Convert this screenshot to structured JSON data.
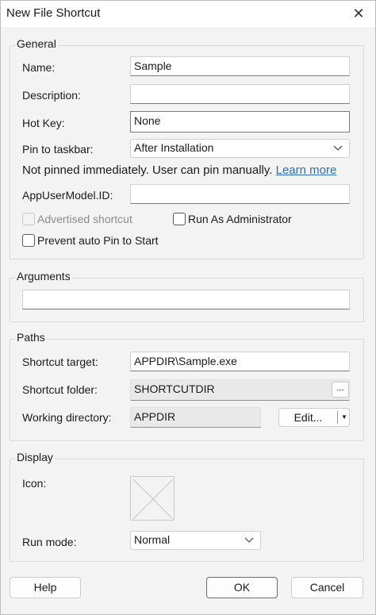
{
  "window": {
    "title": "New File Shortcut",
    "close_glyph": "✕"
  },
  "general": {
    "title": "General",
    "name_label": "Name:",
    "name_value": "Sample",
    "description_label": "Description:",
    "description_value": "",
    "hotkey_label": "Hot Key:",
    "hotkey_value": "None",
    "pin_label": "Pin to taskbar:",
    "pin_value": "After Installation",
    "pin_note": "Not pinned immediately. User can pin manually.",
    "learn_more": "Learn more",
    "appusermodel_label": "AppUserModel.ID:",
    "appusermodel_value": "",
    "advertised_label": "Advertised shortcut",
    "run_admin_label": "Run As Administrator",
    "prevent_pin_label": "Prevent auto Pin to Start"
  },
  "arguments": {
    "title": "Arguments",
    "value": ""
  },
  "paths": {
    "title": "Paths",
    "target_label": "Shortcut target:",
    "target_value": "APPDIR\\Sample.exe",
    "folder_label": "Shortcut folder:",
    "folder_value": "SHORTCUTDIR",
    "browse_label": "...",
    "workdir_label": "Working directory:",
    "workdir_value": "APPDIR",
    "edit_label": "Edit..."
  },
  "display": {
    "title": "Display",
    "icon_label": "Icon:",
    "runmode_label": "Run mode:",
    "runmode_value": "Normal"
  },
  "buttons": {
    "help": "Help",
    "ok": "OK",
    "cancel": "Cancel"
  },
  "colors": {
    "link": "#2f6fb8",
    "background": "#f3f3f3"
  }
}
